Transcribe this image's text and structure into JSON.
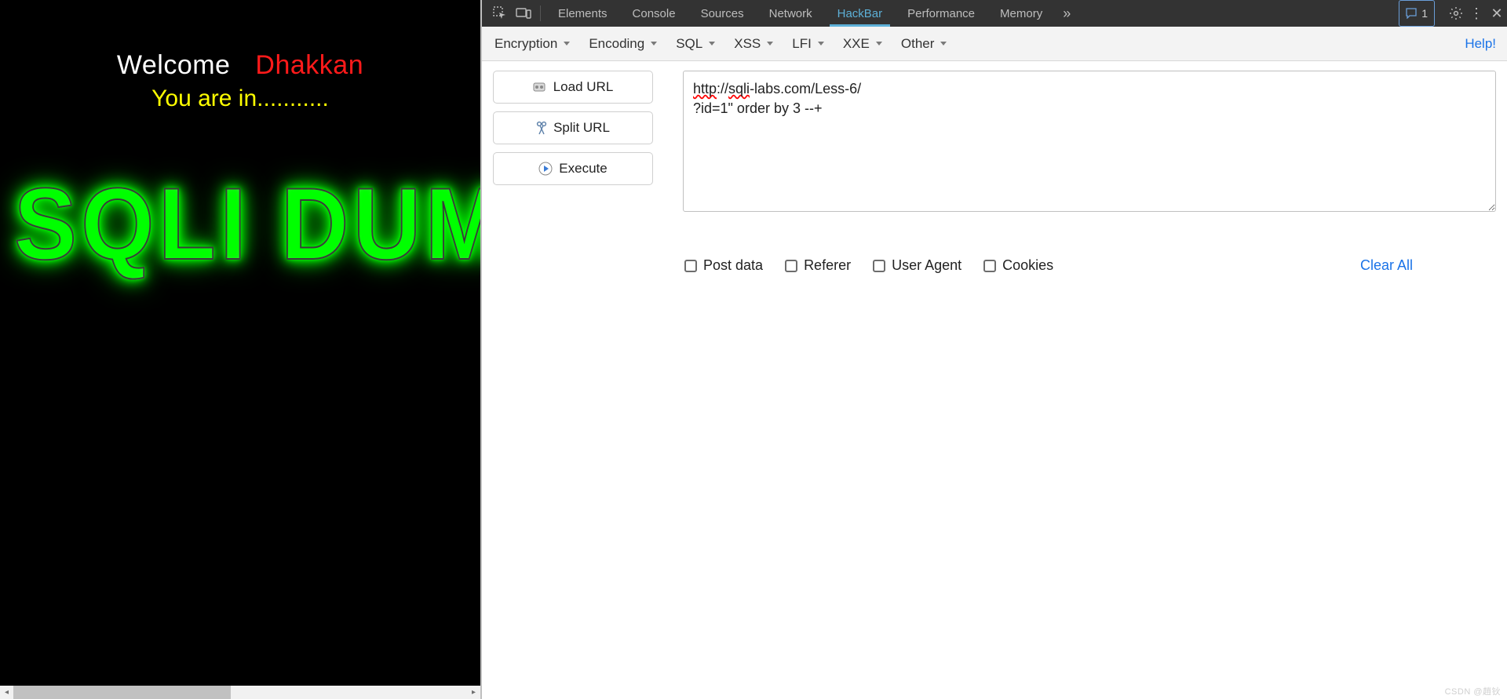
{
  "page": {
    "welcome_label": "Welcome",
    "welcome_name": "Dhakkan",
    "status_line": "You are in...........",
    "banner_text": "SQLI DUMB"
  },
  "devtools": {
    "tabs": {
      "elements": "Elements",
      "console": "Console",
      "sources": "Sources",
      "network": "Network",
      "hackbar": "HackBar",
      "performance": "Performance",
      "memory": "Memory"
    },
    "more_glyph": "»",
    "issue_count": "1"
  },
  "hackbar": {
    "menus": {
      "encryption": "Encryption",
      "encoding": "Encoding",
      "sql": "SQL",
      "xss": "XSS",
      "lfi": "LFI",
      "xxe": "XXE",
      "other": "Other"
    },
    "help": "Help!",
    "buttons": {
      "load_url": "Load URL",
      "split_url": "Split URL",
      "execute": "Execute"
    },
    "url_value_line1_prefix": "http",
    "url_value_line1_mid": "://",
    "url_value_line1_sqli": "sqli",
    "url_value_line1_rest": "-labs.com/Less-6/",
    "url_value_line2": "?id=1\" order by 3 --+",
    "checks": {
      "post_data": "Post data",
      "referer": "Referer",
      "user_agent": "User Agent",
      "cookies": "Cookies"
    },
    "clear_all": "Clear All"
  },
  "watermark": "CSDN @趙钬"
}
